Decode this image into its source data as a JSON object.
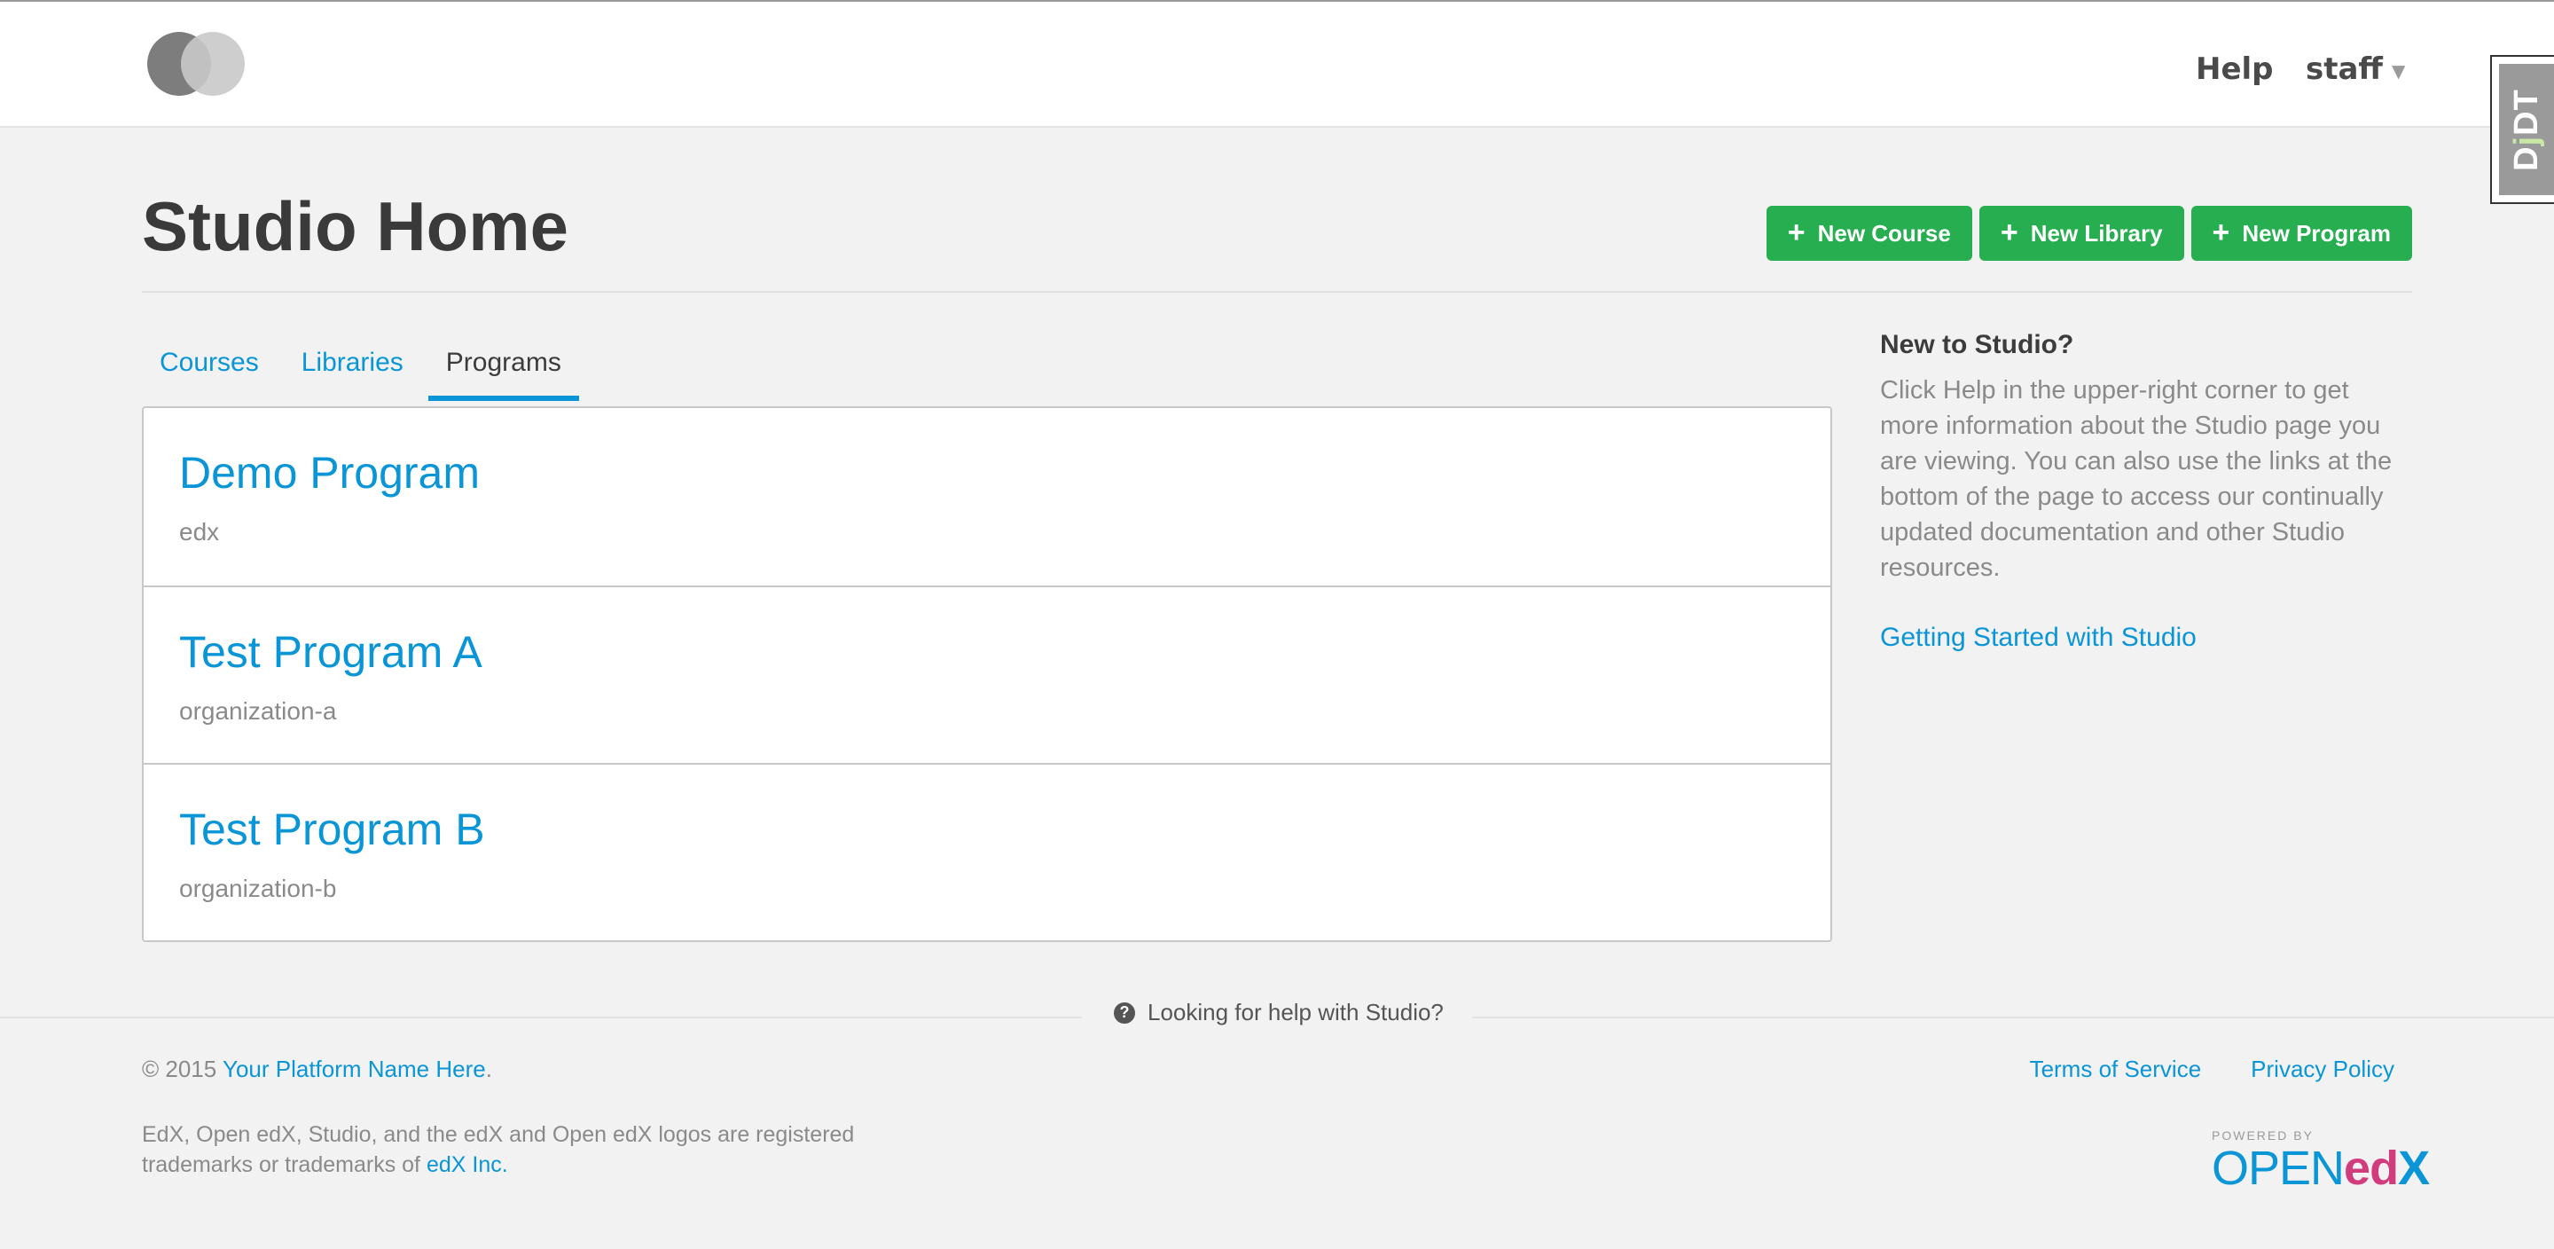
{
  "header": {
    "help_label": "Help",
    "user_label": "staff"
  },
  "debug_toolbar": {
    "label_d": "D",
    "label_j": "j",
    "label_dt": "DT"
  },
  "page": {
    "title": "Studio Home",
    "actions": [
      {
        "label": "New Course"
      },
      {
        "label": "New Library"
      },
      {
        "label": "New Program"
      }
    ]
  },
  "tabs": [
    {
      "label": "Courses",
      "active": false
    },
    {
      "label": "Libraries",
      "active": false
    },
    {
      "label": "Programs",
      "active": true
    }
  ],
  "programs": [
    {
      "title": "Demo Program",
      "org": "edx"
    },
    {
      "title": "Test Program A",
      "org": "organization-a"
    },
    {
      "title": "Test Program B",
      "org": "organization-b"
    }
  ],
  "sidebar": {
    "title": "New to Studio?",
    "text": "Click Help in the upper-right corner to get more information about the Studio page you are viewing. You can also use the links at the bottom of the page to access our continually updated documentation and other Studio resources.",
    "link": "Getting Started with Studio"
  },
  "footer": {
    "help_cta": "Looking for help with Studio?",
    "copyright_prefix": "© 2015",
    "platform_name": "Your Platform Name Here",
    "platform_suffix": ".",
    "trademark_text": "EdX, Open edX, Studio, and the edX and Open edX logos are registered trademarks or trademarks of",
    "edx_link": "edX Inc.",
    "terms": "Terms of Service",
    "privacy": "Privacy Policy",
    "powered_by": "POWERED BY",
    "logo_open": "OPEN",
    "logo_ed": "ed",
    "logo_x": "X"
  },
  "colors": {
    "accent": "#0a95d6",
    "action_green": "#27ae50",
    "background": "#f2f2f2"
  }
}
